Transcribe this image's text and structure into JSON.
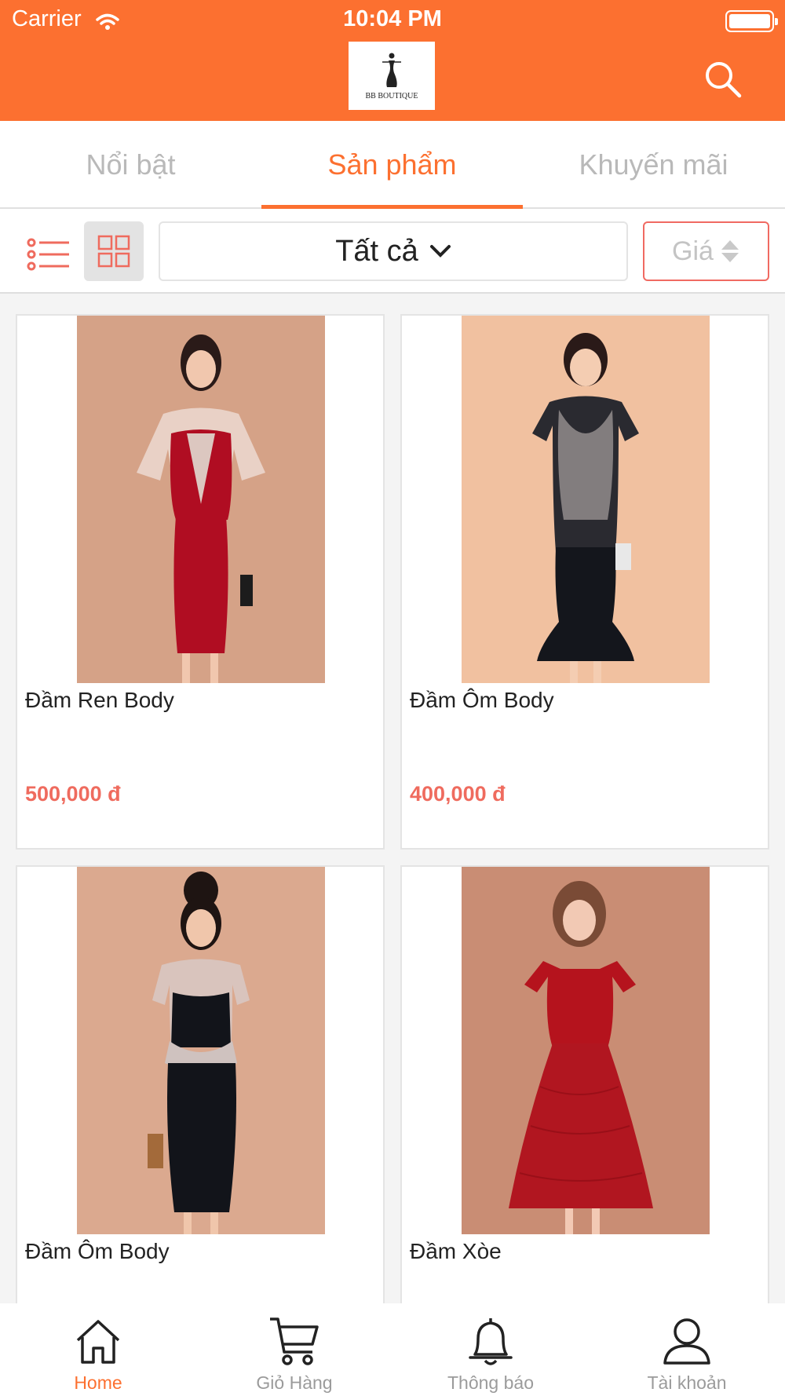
{
  "status_bar": {
    "carrier": "Carrier",
    "time": "10:04 PM"
  },
  "header": {
    "logo_text": "BB BOUTIQUE",
    "search_icon": "search-icon"
  },
  "tabs": [
    {
      "label": "Nổi bật",
      "active": false
    },
    {
      "label": "Sản phẩm",
      "active": true
    },
    {
      "label": "Khuyến mãi",
      "active": false
    }
  ],
  "filter": {
    "list_view_icon": "list-view-icon",
    "grid_view_icon": "grid-view-icon",
    "category_value": "Tất cả",
    "price_sort_label": "Giá"
  },
  "products": [
    {
      "name": "Đầm Ren Body",
      "price": "500,000 đ"
    },
    {
      "name": "Đầm Ôm Body",
      "price": "400,000 đ"
    },
    {
      "name": "Đầm Ôm Body",
      "price": ""
    },
    {
      "name": "Đầm Xòe",
      "price": ""
    }
  ],
  "bottom_nav": [
    {
      "label": "Home",
      "icon": "home-icon",
      "active": true
    },
    {
      "label": "Giỏ Hàng",
      "icon": "cart-icon",
      "active": false
    },
    {
      "label": "Thông báo",
      "icon": "bell-icon",
      "active": false
    },
    {
      "label": "Tài khoản",
      "icon": "user-icon",
      "active": false
    }
  ],
  "colors": {
    "accent": "#fc7030",
    "price": "#ef6b5e",
    "sort_border": "#f06a62"
  }
}
